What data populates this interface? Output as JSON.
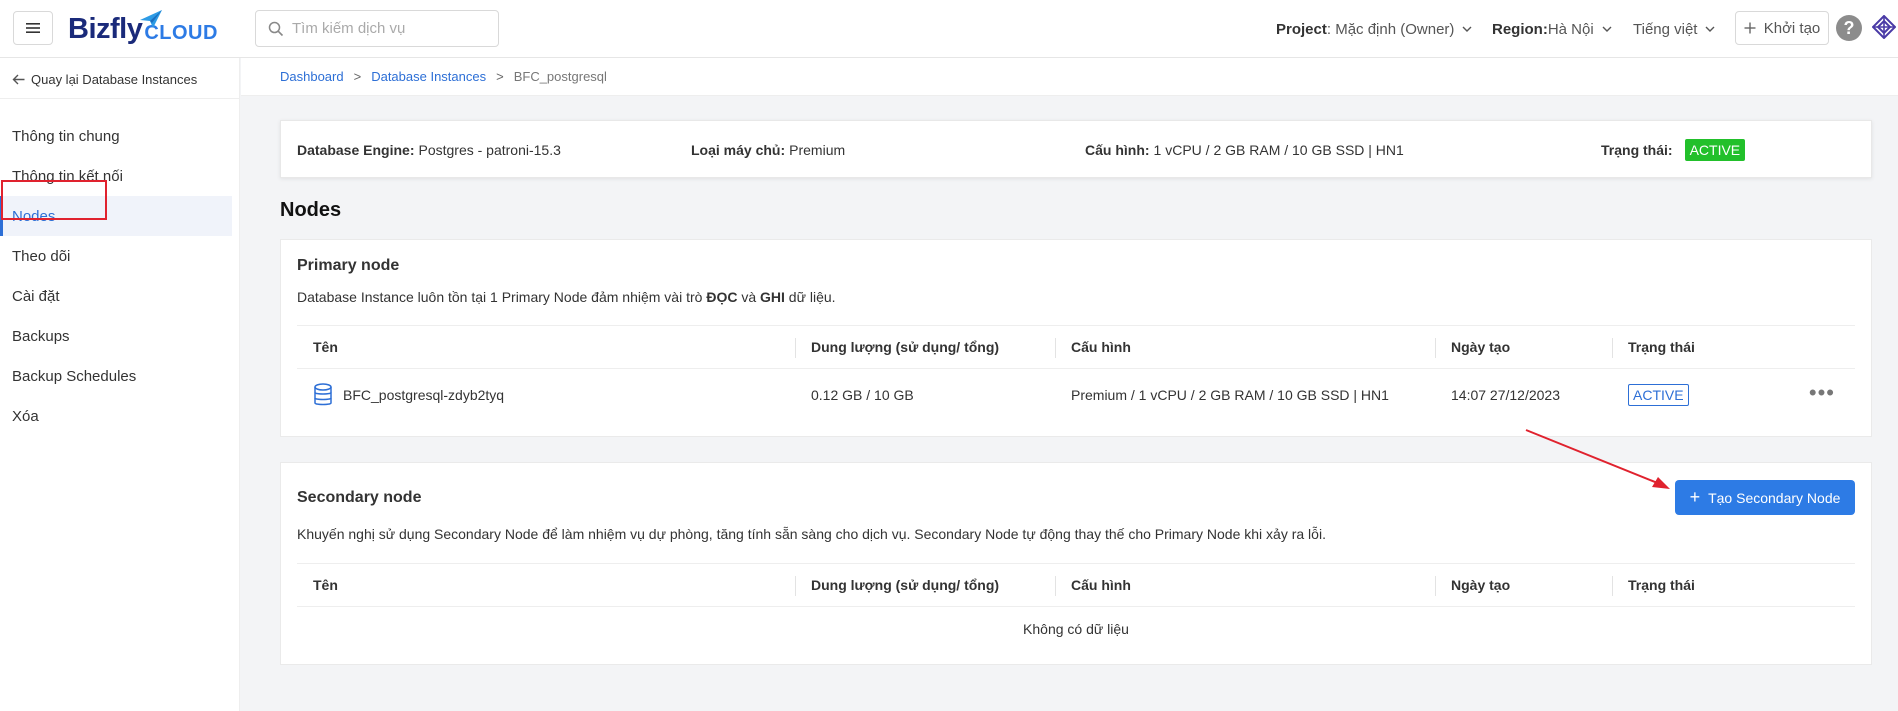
{
  "header": {
    "logo_main": "Bizfly",
    "logo_sub": "CLOUD",
    "search_placeholder": "Tìm kiếm dịch vụ",
    "project_label": "Project",
    "project_value": ": Mặc định (Owner)",
    "region_label": "Region:",
    "region_value": " Hà Nội",
    "language": "Tiếng việt",
    "create_label": "Khởi tạo",
    "help": "?"
  },
  "sidebar": {
    "back_label": "Quay lại Database Instances",
    "items": [
      {
        "label": "Thông tin chung"
      },
      {
        "label": "Thông tin kết nối"
      },
      {
        "label": "Nodes"
      },
      {
        "label": "Theo dõi"
      },
      {
        "label": "Cài đặt"
      },
      {
        "label": "Backups"
      },
      {
        "label": "Backup Schedules"
      },
      {
        "label": "Xóa"
      }
    ],
    "active_index": 2
  },
  "breadcrumb": {
    "items": [
      "Dashboard",
      "Database Instances",
      "BFC_postgresql"
    ],
    "separator": ">"
  },
  "info": {
    "engine_label": "Database Engine:",
    "engine_value": "Postgres - patroni-15.3",
    "server_label": "Loại máy chủ:",
    "server_value": "Premium",
    "config_label": "Cấu hình:",
    "config_value": "1 vCPU / 2 GB RAM / 10 GB SSD | HN1",
    "status_label": "Trạng thái:",
    "status_value": "ACTIVE"
  },
  "page_title": "Nodes",
  "columns": {
    "name": "Tên",
    "storage": "Dung lượng (sử dụng/ tổng)",
    "config": "Cấu hình",
    "created": "Ngày tạo",
    "status": "Trạng thái"
  },
  "primary": {
    "title": "Primary node",
    "desc_prefix": "Database Instance luôn tồn tại 1 Primary Node đảm nhiệm vài trò ",
    "desc_bold1": "ĐỌC",
    "desc_mid": " và ",
    "desc_bold2": "GHI",
    "desc_suffix": " dữ liệu.",
    "row": {
      "name": "BFC_postgresql-zdyb2tyq",
      "storage": "0.12 GB / 10 GB",
      "config": "Premium / 1 vCPU / 2 GB RAM / 10 GB SSD | HN1",
      "created": "14:07 27/12/2023",
      "status": "ACTIVE",
      "more": "•••"
    }
  },
  "secondary": {
    "title": "Secondary node",
    "desc": "Khuyến nghị sử dụng Secondary Node để làm nhiệm vụ dự phòng, tăng tính sẵn sàng cho dịch vụ. Secondary Node tự động thay thế cho Primary Node khi xảy ra lỗi.",
    "create_button": "Tạo Secondary Node",
    "empty": "Không có dữ liệu"
  },
  "colors": {
    "accent": "#2d7be5",
    "link": "#2d6fd6",
    "status_active": "#22c02b",
    "annotation": "#e0222e"
  }
}
